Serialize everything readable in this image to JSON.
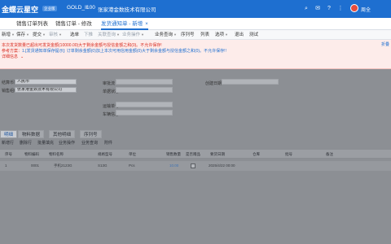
{
  "app": {
    "logo_text": "金蝶云星空",
    "edition_badge": "企业版",
    "db_name": "GOLD_Il",
    "org_code": "100",
    "org_name": "张家港金数技术有限公司",
    "user_name": "周全"
  },
  "tabs": [
    {
      "label": "销售订单列表"
    },
    {
      "label": "销售订单 - 修改"
    },
    {
      "label": "发货通知单 - 新增",
      "close": "×"
    }
  ],
  "toolbar": {
    "items": [
      {
        "label": "新增"
      },
      {
        "label": "保存"
      },
      {
        "label": "提交"
      },
      {
        "label": "审核"
      },
      {
        "label": "选单"
      },
      {
        "label": "下推"
      },
      {
        "label": "关联查询"
      },
      {
        "label": "业务操作"
      },
      {
        "label": "业务查询"
      },
      {
        "label": "序列号"
      },
      {
        "label": "列表"
      },
      {
        "label": "选项"
      },
      {
        "label": "退出"
      },
      {
        "label": "测试"
      }
    ]
  },
  "alert": {
    "line1": "本次发货数量已超出可发货金额(10000.00)大于剩余金额与授信金额之和(0)。不允许保存!",
    "line2_prefix": "参考方案：",
    "line2_link": "1.[发货通知单保存提示]: 订单剩余金额(0)加上本次可用信用金额(0)大于剩余金额与授信金额之和(0)。不允许保存!!",
    "line3": "详细信息",
    "link_right": "折叠"
  },
  "form": {
    "label_settle_currency": "结算币别",
    "value_settle_currency": "人民币",
    "label_sale_org": "销售组织",
    "value_sale_org": "张家港金数技术有限公司",
    "label_right1": "审批流",
    "label_right2": "单据状态",
    "label_right3": "创建日期",
    "label_right4": "运输单号",
    "label_right5": "车辆信息"
  },
  "subtabs": [
    {
      "label": "明细"
    },
    {
      "label": "物料数据"
    },
    {
      "label": "其他明细"
    },
    {
      "label": "序列号"
    }
  ],
  "grid_toolbar": [
    "新增行",
    "删除行",
    "批量填充",
    "业务操作",
    "业务查询",
    "附件"
  ],
  "grid": {
    "headers": [
      "序号",
      "物料编码",
      "物料名称",
      "规格型号",
      "单位",
      "销售数量",
      "是否赠品",
      "要货日期",
      "仓库",
      "批号",
      "备注"
    ],
    "rows": [
      {
        "seq": "1",
        "code": "0001",
        "name": "手机2123G",
        "spec": "S13G",
        "unit": "Pcs",
        "qty": "10.00",
        "gift": "",
        "date": "2025/4/22 00:00",
        "stock": "",
        "lot": "",
        "note": ""
      }
    ]
  }
}
